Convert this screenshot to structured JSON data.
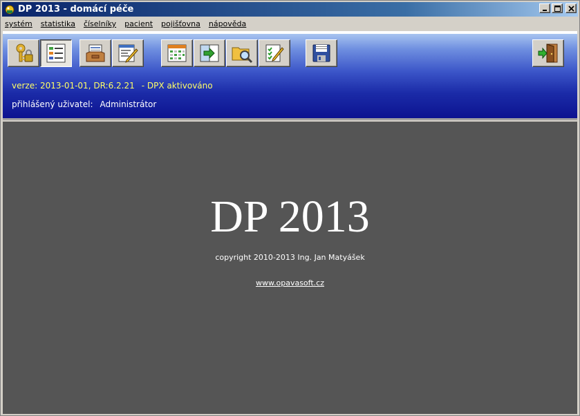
{
  "window": {
    "title": "DP 2013 - domácí péče",
    "minimize": "_",
    "maximize": "□",
    "close": "✕"
  },
  "menu": [
    {
      "label": "systém"
    },
    {
      "label": "statistika"
    },
    {
      "label": "číselníky"
    },
    {
      "label": "pacient"
    },
    {
      "label": "pojišťovna"
    },
    {
      "label": "nápověda"
    }
  ],
  "toolbar": {
    "buttons": [
      {
        "icon": "keys-lock-icon"
      },
      {
        "icon": "list-form-icon",
        "pressed": true
      },
      {
        "icon": "inbox-tray-icon"
      },
      {
        "icon": "edit-form-icon"
      },
      {
        "icon": "calendar-grid-icon"
      },
      {
        "icon": "arrow-panel-icon"
      },
      {
        "icon": "folder-search-icon"
      },
      {
        "icon": "checklist-icon"
      },
      {
        "icon": "save-disk-icon"
      },
      {
        "icon": "exit-door-icon"
      }
    ]
  },
  "info": {
    "version": "verze: 2013-01-01, DR:6.2.21",
    "dpx": "- DPX aktivováno",
    "user_label": "přihlášený uživatel:",
    "user_value": "Administrátor"
  },
  "main": {
    "app_title": "DP 2013",
    "copyright": "copyright 2010-2013 Ing. Jan Matyášek",
    "website": "www.opavasoft.cz"
  },
  "colors": {
    "banner_top": "#a8c4f0",
    "banner_bottom": "#0c1390",
    "main_bg": "#555555",
    "version_text": "#ffff66"
  }
}
